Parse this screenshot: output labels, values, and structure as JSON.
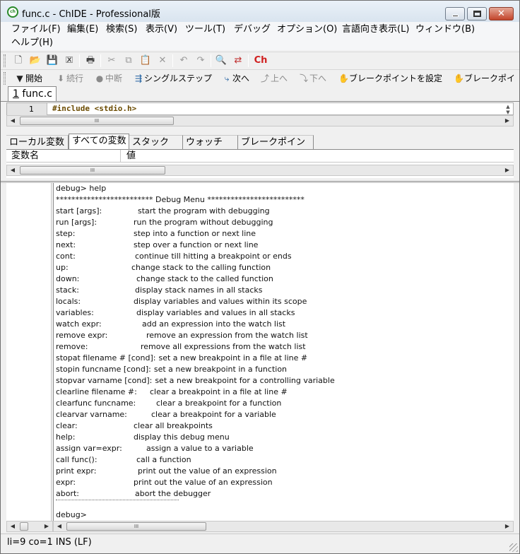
{
  "window": {
    "title": "func.c - ChIDE - Professional版",
    "app_icon_text": "ch",
    "minimize_glyph": "",
    "close_glyph": "✕"
  },
  "menu": [
    "ファイル(F)",
    "編集(E)",
    "検索(S)",
    "表示(V)",
    "ツール(T)",
    "デバッグ",
    "オプション(O)",
    "言語向き表示(L)",
    "ウィンドウ(B)",
    "ヘルプ(H)"
  ],
  "toolbar": {
    "icons": [
      "new-file-icon",
      "open-file-icon",
      "save-icon",
      "close-file-icon",
      "print-icon",
      "cut-icon",
      "copy-icon",
      "paste-icon",
      "delete-icon",
      "undo-icon",
      "redo-icon",
      "find-icon",
      "replace-icon",
      "ch-icon"
    ],
    "ch_label": "Ch"
  },
  "debugbar": {
    "start": "開始",
    "continue": "続行",
    "abort": "中断",
    "single_step": "シングルステップ",
    "next": "次へ",
    "up": "上へ",
    "down": "下へ",
    "set_breakpoint": "ブレークポイントを設定",
    "breakpoint_truncated": "ブレークポイ"
  },
  "file_tab": {
    "number": "1",
    "name": "func.c"
  },
  "editor": {
    "line_number": "1",
    "code": "#include <stdio.h>"
  },
  "var_panel": {
    "tabs": [
      "ローカル変数",
      "すべての変数",
      "スタック",
      "ウォッチ",
      "ブレークポイント"
    ],
    "active_tab": 1,
    "columns": [
      "変数名",
      "値"
    ]
  },
  "scrollbar": {
    "thumb_grip": "III"
  },
  "console": {
    "prompt_line": "debug> help",
    "banner": "************************* Debug Menu *************************",
    "commands": [
      {
        "cmd": "start [args]:",
        "desc": "start the program with debugging"
      },
      {
        "cmd": "run [args]:",
        "desc": "run the program without debugging"
      },
      {
        "cmd": "step:",
        "desc": "step into a function or next line"
      },
      {
        "cmd": "next:",
        "desc": "step over a function or next line"
      },
      {
        "cmd": "cont:",
        "desc": "continue till hitting a breakpoint or ends"
      },
      {
        "cmd": "up:",
        "desc": "change stack to the calling function"
      },
      {
        "cmd": "down:",
        "desc": "change stack to the called function"
      },
      {
        "cmd": "stack:",
        "desc": "display stack names in all stacks"
      },
      {
        "cmd": "locals:",
        "desc": "display variables and values within its scope"
      },
      {
        "cmd": "variables:",
        "desc": "display variables and values in all stacks"
      },
      {
        "cmd": "watch expr:",
        "desc": "add an expression into the watch list"
      },
      {
        "cmd": "remove expr:",
        "desc": "remove an expression from the watch list"
      },
      {
        "cmd": "remove:",
        "desc": "remove all expressions from the watch list"
      },
      {
        "cmd": "stopat filename # [cond]:",
        "desc": "set a new breakpoint in a file at line #"
      },
      {
        "cmd": "stopin funcname [cond]:",
        "desc": "set a new breakpoint in a function"
      },
      {
        "cmd": "stopvar varname [cond]:",
        "desc": "set a new breakpoint for a controlling variable"
      },
      {
        "cmd": "clearline filename #:",
        "desc": "clear a breakpoint in a file at line #"
      },
      {
        "cmd": "clearfunc funcname:",
        "desc": "clear a breakpoint for a function"
      },
      {
        "cmd": "clearvar varname:",
        "desc": "clear a breakpoint for a variable"
      },
      {
        "cmd": "clear:",
        "desc": "clear all breakpoints"
      },
      {
        "cmd": "help:",
        "desc": "display this debug menu"
      },
      {
        "cmd": "assign var=expr:",
        "desc": "assign a value to a variable"
      },
      {
        "cmd": "call func():",
        "desc": "call a function"
      },
      {
        "cmd": "print expr:",
        "desc": "print out the value of an expression"
      },
      {
        "cmd": "expr:",
        "desc": "print out the value of an expression"
      },
      {
        "cmd": "abort:",
        "desc": "abort the debugger"
      }
    ],
    "final_prompt": "debug>"
  },
  "status": {
    "text": "li=9 co=1 INS (LF)"
  }
}
